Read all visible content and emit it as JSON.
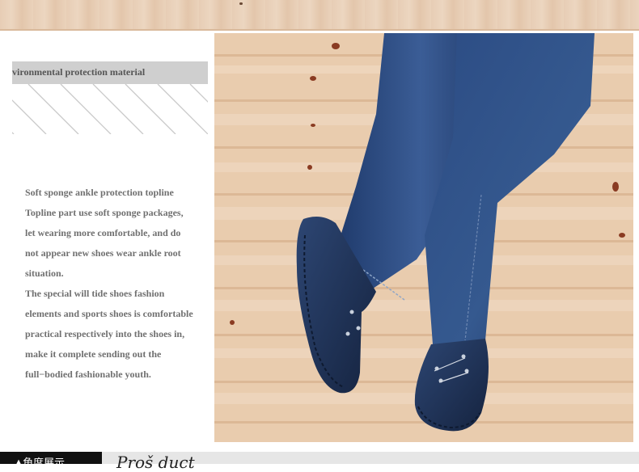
{
  "header": {
    "section_title": "vironmental protection material"
  },
  "description": {
    "lines": [
      "Soft sponge ankle protection topline",
      "Topline part use soft sponge packages,",
      "let wearing more comfortable, and do",
      "not appear new shoes wear ankle root",
      "situation.",
      "The special will tide shoes fashion",
      "elements and sports shoes is comfortable",
      " practical respectively into the shoes in,",
      "make it complete sending out the",
      "full−bodied fashionable youth."
    ]
  },
  "footer": {
    "tab_label": "▲角度展示",
    "script_text": "Proš duct"
  },
  "colors": {
    "jeans": "#2f4f86",
    "shoe": "#1e2f55",
    "wood": "#e8c8a7"
  }
}
